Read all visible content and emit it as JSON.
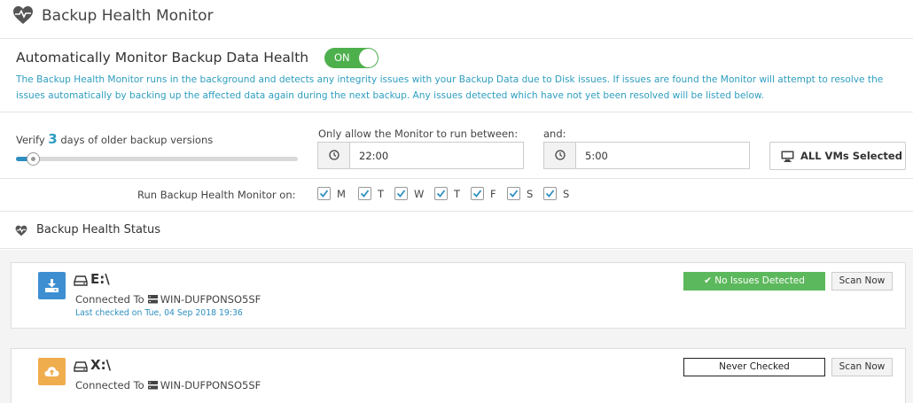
{
  "header": {
    "title": "Backup Health Monitor",
    "icon": "heart-pulse-icon"
  },
  "auto_monitor": {
    "title": "Automatically Monitor Backup Data Health",
    "toggle_label": "ON",
    "toggle_state": true,
    "description": "The Backup Health Monitor runs in the background and detects any integrity issues with your Backup Data due to Disk issues. If issues are found the Monitor will attempt to resolve the issues automatically by backing up the affected data again during the next backup. Any issues detected which have not yet been resolved will be listed below."
  },
  "verify": {
    "prefix": "Verify",
    "days": "3",
    "suffix": "days of older backup versions",
    "slider_fraction": 0.06
  },
  "schedule": {
    "between_label": "Only allow the Monitor to run between:",
    "start_time": "22:00",
    "and_label": "and:",
    "end_time": "5:00"
  },
  "vms_button": {
    "label": "ALL VMs Selected",
    "icon": "monitor-icon"
  },
  "days": {
    "label": "Run Backup Health Monitor on:",
    "items": [
      {
        "label": "M",
        "checked": true
      },
      {
        "label": "T",
        "checked": true
      },
      {
        "label": "W",
        "checked": true
      },
      {
        "label": "T",
        "checked": true
      },
      {
        "label": "F",
        "checked": true
      },
      {
        "label": "S",
        "checked": true
      },
      {
        "label": "S",
        "checked": true
      }
    ]
  },
  "status": {
    "title": "Backup Health Status",
    "drives": [
      {
        "name": "E:\\",
        "icon": "download-icon",
        "icon_color": "#3d8fd1",
        "connected_prefix": "Connected To",
        "server": "WIN-DUFPONSO5SF",
        "last_checked": "Last checked on Tue, 04 Sep 2018 19:36",
        "badge": "No Issues Detected",
        "badge_color": "#5cb85c",
        "scan_label": "Scan Now"
      },
      {
        "name": "X:\\",
        "icon": "cloud-upload-icon",
        "icon_color": "#f0ad4e",
        "connected_prefix": "Connected To",
        "server": "WIN-DUFPONSO5SF",
        "badge": "Never Checked",
        "scan_label": "Scan Now"
      }
    ]
  }
}
